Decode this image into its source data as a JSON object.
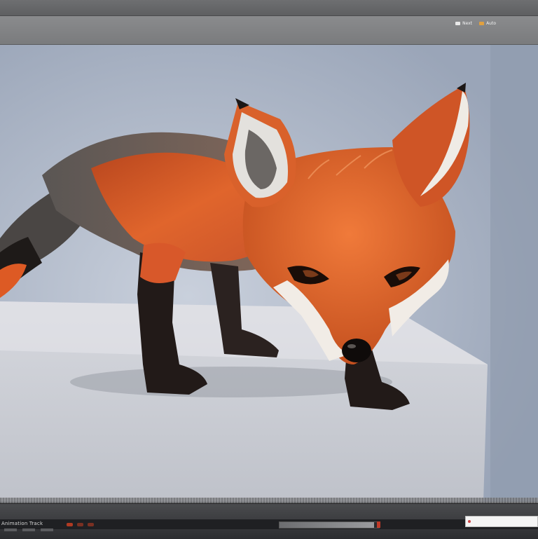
{
  "window": {
    "title": ""
  },
  "toolbar": {
    "status_items": [
      {
        "icon": "camera-icon",
        "label": "Next"
      },
      {
        "icon": "render-icon",
        "label": "Auto"
      }
    ]
  },
  "viewport": {
    "scene": "fox-3d-render",
    "colors": {
      "fur": "#d95a2b",
      "background": "#b3bccb",
      "pedestal": "#d2d3d8"
    }
  },
  "timeline": {
    "track_label": "Animation Track",
    "progress_value": 0.95
  },
  "search": {
    "placeholder": ""
  }
}
